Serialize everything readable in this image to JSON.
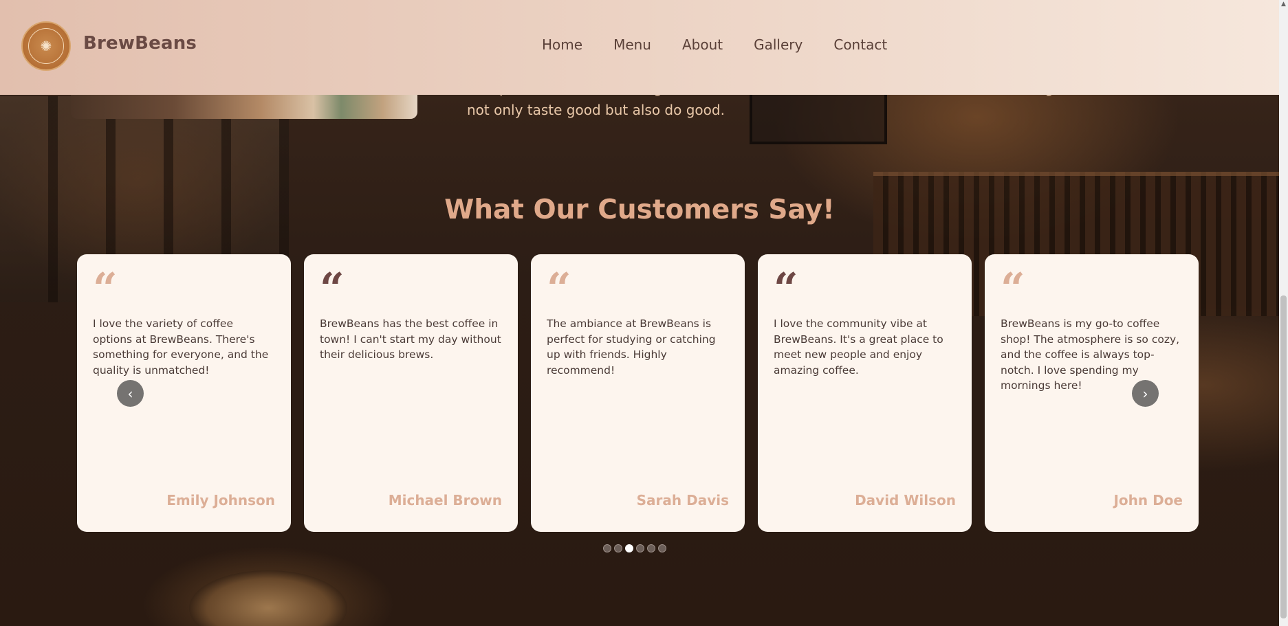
{
  "header": {
    "brand": "BrewBeans",
    "logo_icon": "coffee-bean-logo",
    "nav": [
      "Home",
      "Menu",
      "About",
      "Gallery",
      "Contact"
    ]
  },
  "about": {
    "text_partial_line": "that prioritize the well-being of their workers and the environment. We believe that great coffee should",
    "text_last_line": "not only taste good but also do good."
  },
  "testimonials": {
    "title": "What Our Customers Say!",
    "cards": [
      {
        "quote_style": "light",
        "text": "I love the variety of coffee options at BrewBeans. There's something for everyone, and the quality is unmatched!",
        "name": "Emily Johnson"
      },
      {
        "quote_style": "dark",
        "text": "BrewBeans has the best coffee in town! I can't start my day without their delicious brews.",
        "name": "Michael Brown"
      },
      {
        "quote_style": "light",
        "text": "The ambiance at BrewBeans is perfect for studying or catching up with friends. Highly recommend!",
        "name": "Sarah Davis"
      },
      {
        "quote_style": "dark",
        "text": "I love the community vibe at BrewBeans. It's a great place to meet new people and enjoy amazing coffee.",
        "name": "David Wilson"
      },
      {
        "quote_style": "light",
        "text": "BrewBeans is my go-to coffee shop! The atmosphere is so cozy, and the coffee is always top-notch. I love spending my mornings here!",
        "name": "John Doe"
      }
    ],
    "prev_icon": "chevron-left-icon",
    "next_icon": "chevron-right-icon",
    "dots_count": 6,
    "active_dot": 3
  },
  "colors": {
    "accent": "#e0a98a",
    "brand_text": "#6a4a44",
    "card_bg": "#fdf5ee"
  }
}
